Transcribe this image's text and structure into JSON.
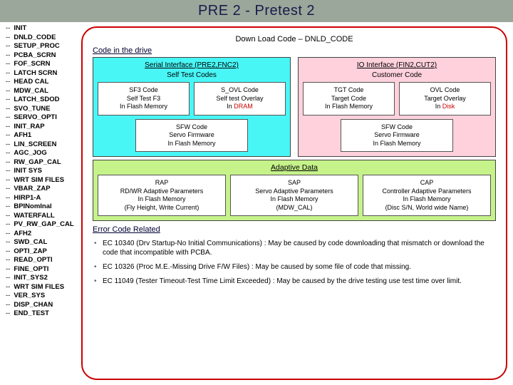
{
  "title": "PRE 2 - Pretest 2",
  "sidebar": {
    "prefix": "--",
    "items": [
      "INIT",
      "DNLD_CODE",
      "SETUP_PROC",
      "PCBA_SCRN",
      "FOF_SCRN",
      "LATCH SCRN",
      "HEAD CAL",
      "MDW_CAL",
      "LATCH_SDOD",
      "SVO_TUNE",
      "SERVO_OPTI",
      "INIT_RAP",
      "AFH1",
      "LIN_SCREEN",
      "AGC_JOG",
      "RW_GAP_CAL",
      "INIT SYS",
      "WRT SIM FILES",
      "VBAR_ZAP",
      "HIRP1-A",
      "BPINomInal",
      "WATERFALL",
      "PV_RW_GAP_CAL",
      "AFH2",
      "SWD_CAL",
      "OPTI_ZAP",
      "READ_OPTI",
      "FINE_OPTI",
      "INIT_SYS2",
      "WRT SIM FILES",
      "VER_SYS",
      "DISP_CHAN",
      "END_TEST"
    ]
  },
  "main": {
    "headline": "Down Load Code – DNLD_CODE",
    "drive_label": "Code in the drive",
    "serial": {
      "header": "Serial Interface (PRE2,FNC2)",
      "sub": "Self Test Codes",
      "sf3": {
        "l1": "SF3 Code",
        "l2": "Self Test F3",
        "l3": "In Flash Memory"
      },
      "sovl": {
        "l1": "S_OVL Code",
        "l2": "Self test Overlay",
        "l3": "In ",
        "l3r": "DRAM"
      },
      "sfw": {
        "l1": "SFW Code",
        "l2": "Servo Firmware",
        "l3": "In Flash Memory"
      }
    },
    "io": {
      "header": "IO Interface (FIN2,CUT2)",
      "sub": "Customer Code",
      "tgt": {
        "l1": "TGT Code",
        "l2": "Target Code",
        "l3": "In Flash Memory"
      },
      "ovl": {
        "l1": "OVL Code",
        "l2": "Target Overlay",
        "l3": "In ",
        "l3r": "Disk"
      },
      "sfw": {
        "l1": "SFW Code",
        "l2": "Servo Firmware",
        "l3": "In Flash Memory"
      }
    },
    "adaptive": {
      "header": "Adaptive Data",
      "rap": {
        "l1": "RAP",
        "l2": "RD/WR Adaptive Parameters",
        "l3": "In Flash Memory",
        "l4": "(Fly Height, Write Current)"
      },
      "sap": {
        "l1": "SAP",
        "l2": "Servo Adaptive Parameters",
        "l3": "In Flash Memory",
        "l4": "(MDW_CAL)"
      },
      "cap": {
        "l1": "CAP",
        "l2": "Controller Adaptive Parameters",
        "l3": "In Flash Memory",
        "l4": "(Disc S/N, World wide Name)"
      }
    },
    "err_label": "Error Code Related",
    "errors": [
      "EC 10340 (Drv Startup-No Initial Communications) : May be caused by code downloading that mismatch or download the code that incompatible with PCBA.",
      "EC 10326 (Proc M.E.-Missing Drive F/W Files) : May be caused by some file of code that missing.",
      "EC 11049 (Tester Timeout-Test Time Limit Exceeded) : May be caused by the drive testing use test time over limit."
    ]
  }
}
